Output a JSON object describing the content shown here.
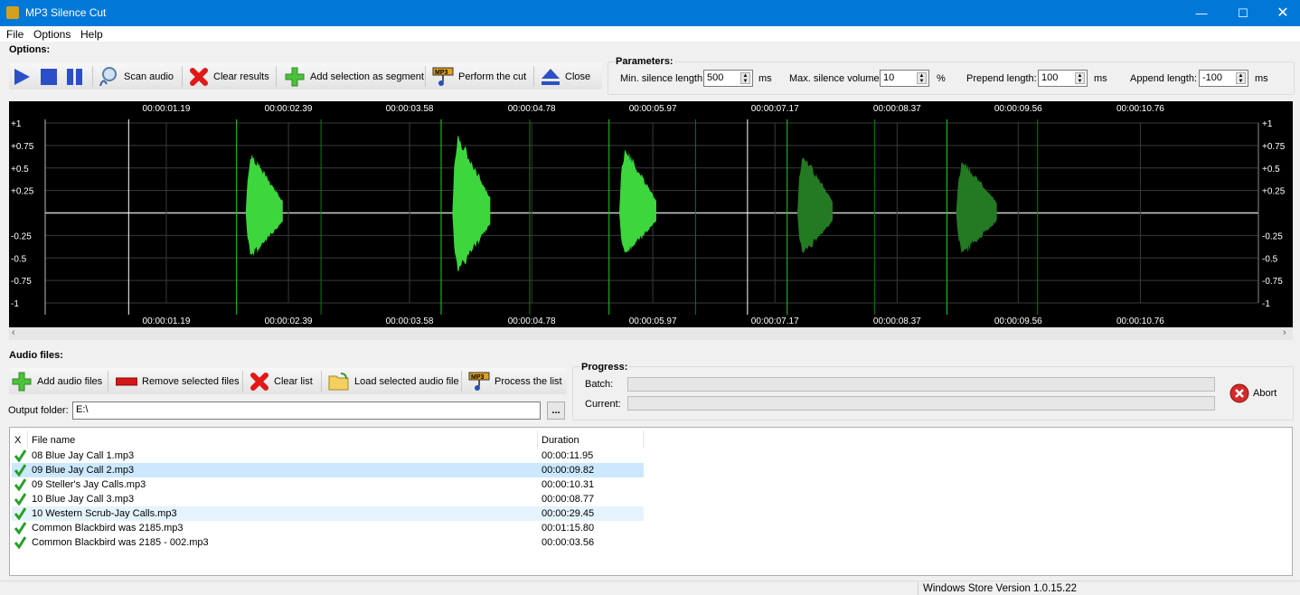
{
  "window": {
    "title": "MP3 Silence Cut",
    "controls": [
      "minimize",
      "maximize",
      "close"
    ]
  },
  "menu": [
    "File",
    "Options",
    "Help"
  ],
  "options": {
    "label": "Options:",
    "toolbar": [
      {
        "icon": "play-icon",
        "label": ""
      },
      {
        "icon": "stop-icon",
        "label": ""
      },
      {
        "icon": "pause-icon",
        "label": ""
      },
      {
        "icon": "scan-icon",
        "label": "Scan audio"
      },
      {
        "icon": "red-x-icon",
        "label": "Clear results"
      },
      {
        "icon": "green-plus-icon",
        "label": "Add selection as segment"
      },
      {
        "icon": "mp3-scissors-icon",
        "label": "Perform the cut"
      },
      {
        "icon": "eject-icon",
        "label": "Close"
      }
    ]
  },
  "parameters": {
    "label": "Parameters:",
    "fields": [
      {
        "label": "Min. silence length:",
        "value": "500",
        "unit": "ms"
      },
      {
        "label": "Max. silence volume:",
        "value": "10",
        "unit": "%"
      },
      {
        "label": "Prepend length:",
        "value": "100",
        "unit": "ms"
      },
      {
        "label": "Append length:",
        "value": "-100",
        "unit": "ms"
      }
    ]
  },
  "waveform": {
    "time_labels": [
      "00:00:01.19",
      "00:00:02.39",
      "00:00:03.58",
      "00:00:04.78",
      "00:00:05.97",
      "00:00:07.17",
      "00:00:08.37",
      "00:00:09.56",
      "00:00:10.76"
    ],
    "time_range_s": [
      0,
      11.92
    ],
    "amplitude_labels": [
      "+1",
      "+0.75",
      "+0.5",
      "+0.25",
      "",
      "-0.25",
      "-0.5",
      "-0.75",
      "-1"
    ],
    "selection_markers_s": [
      0.82,
      6.9
    ],
    "segments_s": [
      [
        1.88,
        2.71
      ],
      [
        3.89,
        4.76
      ],
      [
        5.54,
        6.39
      ],
      [
        7.29,
        8.15
      ],
      [
        8.86,
        9.75
      ]
    ],
    "sounds": [
      {
        "start": 1.97,
        "end": 2.33,
        "peak_pos": 0.7,
        "peak_neg": 0.55,
        "active": true
      },
      {
        "start": 4.0,
        "end": 4.37,
        "peak_pos": 0.92,
        "peak_neg": 0.73,
        "active": true
      },
      {
        "start": 5.64,
        "end": 6.0,
        "peak_pos": 0.77,
        "peak_neg": 0.53,
        "active": true
      },
      {
        "start": 7.39,
        "end": 7.74,
        "peak_pos": 0.7,
        "peak_neg": 0.52,
        "active": false
      },
      {
        "start": 8.95,
        "end": 9.35,
        "peak_pos": 0.63,
        "peak_neg": 0.52,
        "active": false
      }
    ],
    "colors": {
      "active": "#3dd63d",
      "inactive": "#237a23",
      "segment_start": "#22cc22",
      "segment_end": "#117711",
      "marker": "#ffffff",
      "grid": "#3a3a3a"
    }
  },
  "audio_files": {
    "label": "Audio files:",
    "toolbar": [
      {
        "icon": "green-plus-icon",
        "label": "Add audio files"
      },
      {
        "icon": "red-minus-icon",
        "label": "Remove selected files"
      },
      {
        "icon": "red-x-icon",
        "label": "Clear list"
      },
      {
        "icon": "folder-icon",
        "label": "Load selected audio file"
      },
      {
        "icon": "mp3-scissors-icon",
        "label": "Process the list"
      }
    ],
    "output_folder_label": "Output folder:",
    "output_folder_value": "E:\\",
    "browse_label": "...",
    "columns": [
      "X",
      "File name",
      "Duration"
    ],
    "rows": [
      {
        "name": "08 Blue Jay Call 1.mp3",
        "duration": "00:00:11.95",
        "state": "normal"
      },
      {
        "name": "09 Blue Jay Call 2.mp3",
        "duration": "00:00:09.82",
        "state": "selected"
      },
      {
        "name": "09 Steller's Jay Calls.mp3",
        "duration": "00:00:10.31",
        "state": "normal"
      },
      {
        "name": "10 Blue Jay Call 3.mp3",
        "duration": "00:00:08.77",
        "state": "normal"
      },
      {
        "name": "10 Western Scrub-Jay Calls.mp3",
        "duration": "00:00:29.45",
        "state": "hover"
      },
      {
        "name": "Common Blackbird was 2185.mp3",
        "duration": "00:01:15.80",
        "state": "normal"
      },
      {
        "name": "Common Blackbird was 2185 - 002.mp3",
        "duration": "00:00:03.56",
        "state": "normal"
      }
    ]
  },
  "progress": {
    "label": "Progress:",
    "batch_label": "Batch:",
    "batch_value": 0,
    "current_label": "Current:",
    "current_value": 0,
    "abort_label": "Abort"
  },
  "status": {
    "version": "Windows Store Version 1.0.15.22"
  }
}
